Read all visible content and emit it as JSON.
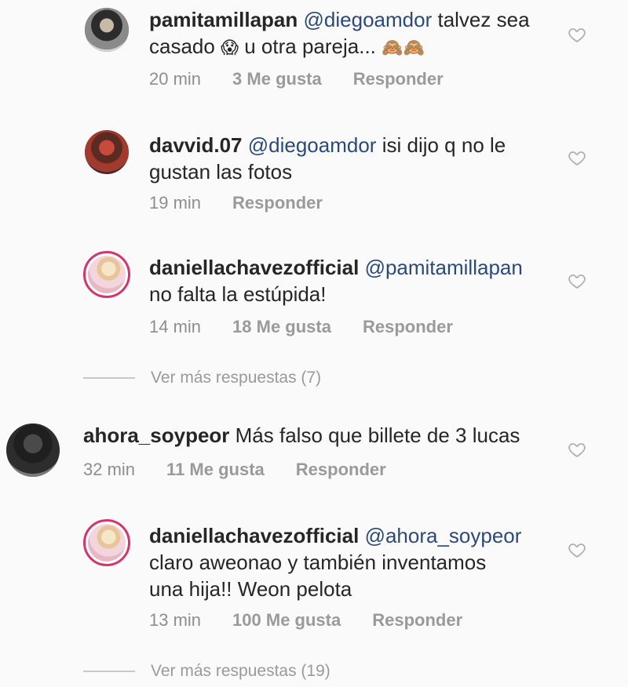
{
  "comments": [
    {
      "username": "pamitamillapan",
      "mention": "@diegoamdor",
      "text_line1": "talvez sea",
      "text_line2": "casado",
      "emoji1": "😱",
      "text_line2b": "u otra pareja...",
      "emoji2": "🙈🙈",
      "time": "20 min",
      "likes": "3 Me gusta",
      "reply": "Responder"
    },
    {
      "username": "davvid.07",
      "mention": "@diegoamdor",
      "text_line1": "isi dijo q no le",
      "text_line2": "gustan las fotos",
      "time": "19 min",
      "reply": "Responder"
    },
    {
      "username": "daniellachavezofficial",
      "mention": "@pamitamillapan",
      "text_line2": "no falta la estúpida!",
      "time": "14 min",
      "likes": "18 Me gusta",
      "reply": "Responder"
    },
    {
      "username": "ahora_soypeor",
      "text_line1": "Más falso que billete de 3 lucas",
      "time": "32 min",
      "likes": "11 Me gusta",
      "reply": "Responder"
    },
    {
      "username": "daniellachavezofficial",
      "mention": "@ahora_soypeor",
      "text_line2": "claro aweonao y también inventamos",
      "text_line3": "una hija!! Weon pelota",
      "time": "13 min",
      "likes": "100 Me gusta",
      "reply": "Responder"
    }
  ],
  "more_replies_1": "Ver más respuestas (7)",
  "more_replies_2": "Ver más respuestas (19)",
  "icons": {
    "heart": "heart-outline-icon"
  }
}
